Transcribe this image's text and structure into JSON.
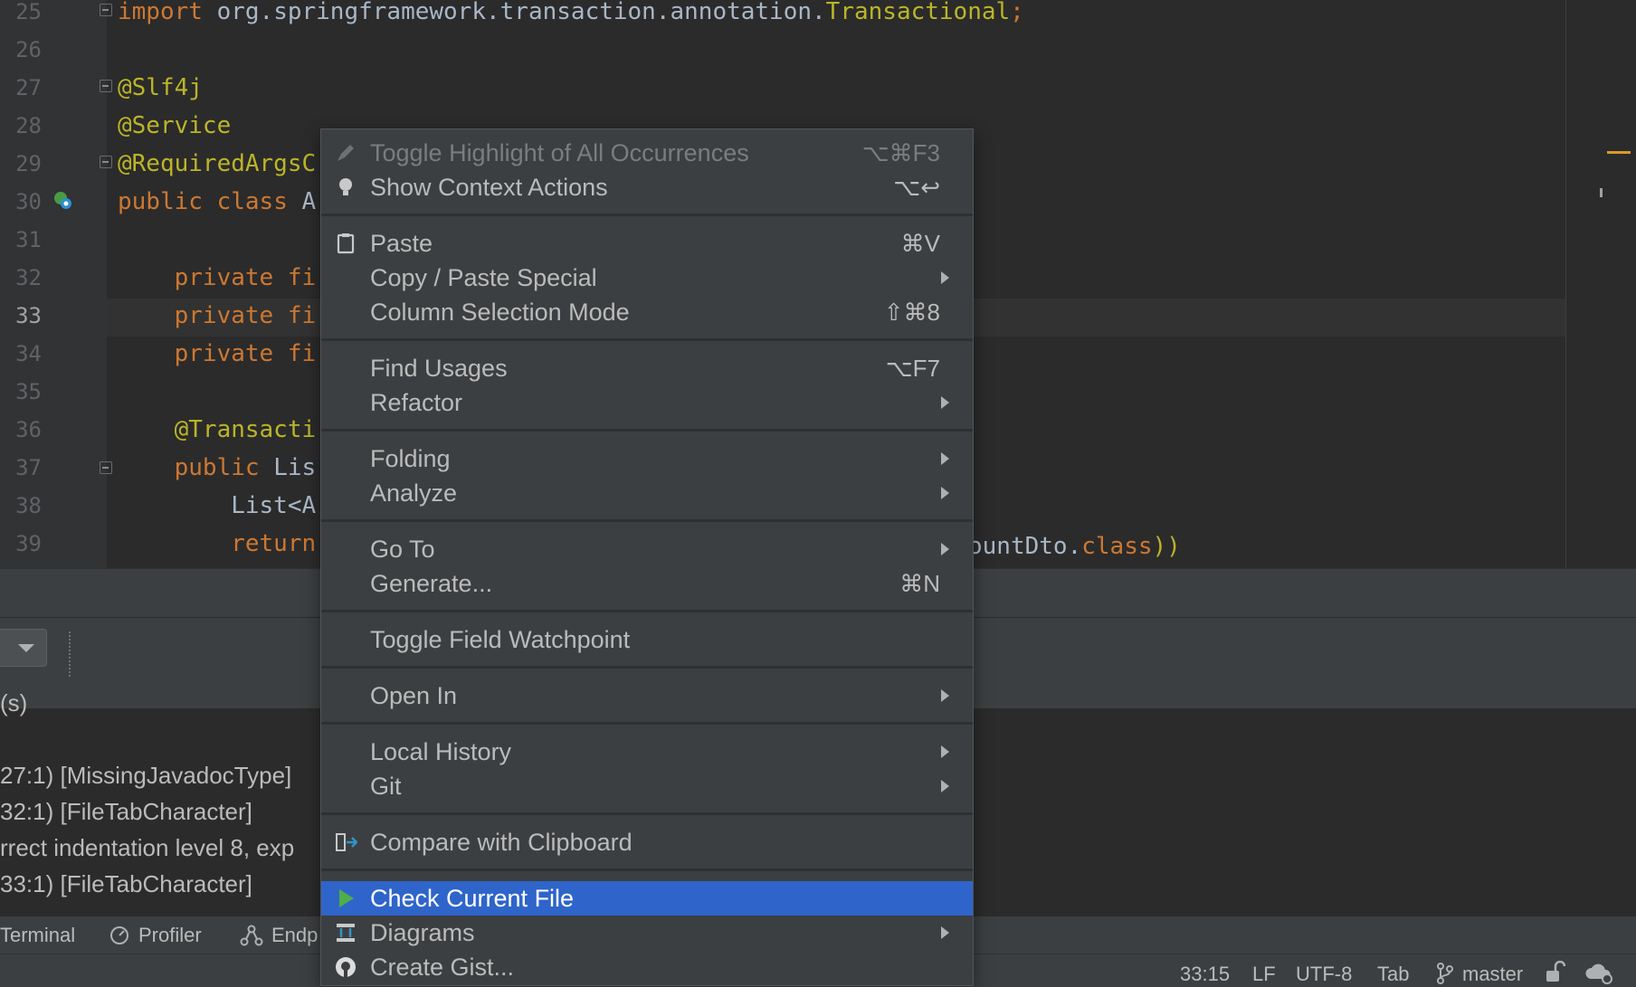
{
  "editor": {
    "lines": [
      {
        "num": "25",
        "segments": [
          {
            "t": "import ",
            "c": "kw"
          },
          {
            "t": "org.springframework.transaction.annotation.",
            "c": "plain"
          },
          {
            "t": "Transactional",
            "c": "ann"
          },
          {
            "t": ";",
            "c": "kw"
          }
        ]
      },
      {
        "num": "26",
        "segments": []
      },
      {
        "num": "27",
        "segments": [
          {
            "t": "@Slf4j",
            "c": "ann"
          }
        ]
      },
      {
        "num": "28",
        "segments": [
          {
            "t": "@Service",
            "c": "ann"
          }
        ]
      },
      {
        "num": "29",
        "segments": [
          {
            "t": "@RequiredArgsC",
            "c": "ann"
          }
        ]
      },
      {
        "num": "30",
        "segments": [
          {
            "t": "public ",
            "c": "kw"
          },
          {
            "t": "class ",
            "c": "kw"
          },
          {
            "t": "A",
            "c": "plain"
          }
        ]
      },
      {
        "num": "31",
        "segments": []
      },
      {
        "num": "32",
        "segments": [
          {
            "t": "    private ",
            "c": "kw"
          },
          {
            "t": "fi",
            "c": "kw"
          }
        ]
      },
      {
        "num": "33",
        "segments": [
          {
            "t": "    private ",
            "c": "kw"
          },
          {
            "t": "fi",
            "c": "kw"
          }
        ]
      },
      {
        "num": "34",
        "segments": [
          {
            "t": "    private ",
            "c": "kw"
          },
          {
            "t": "fi",
            "c": "kw"
          }
        ]
      },
      {
        "num": "35",
        "segments": []
      },
      {
        "num": "36",
        "segments": [
          {
            "t": "    @Transacti",
            "c": "ann"
          }
        ]
      },
      {
        "num": "37",
        "segments": [
          {
            "t": "    public ",
            "c": "kw"
          },
          {
            "t": "Lis",
            "c": "plain"
          }
        ]
      },
      {
        "num": "38",
        "segments": [
          {
            "t": "        List<A",
            "c": "plain"
          }
        ]
      },
      {
        "num": "39",
        "segments": [
          {
            "t": "        return",
            "c": "kw"
          }
        ]
      }
    ],
    "line39_tail": [
      {
        "t": "ountDto.",
        "c": "plain"
      },
      {
        "t": "class",
        "c": "kw"
      },
      {
        "t": "))",
        "c": "ann"
      }
    ]
  },
  "output": {
    "header_fragment": "(s)",
    "rows": [
      "27:1) [MissingJavadocType]",
      "32:1) [FileTabCharacter]",
      "rrect indentation level 8, exp",
      "33:1) [FileTabCharacter]"
    ]
  },
  "tabs": [
    "Terminal",
    "Profiler",
    "Endp"
  ],
  "status": {
    "position": "33:15",
    "line_sep": "LF",
    "encoding": "UTF-8",
    "indent": "Tab",
    "branch": "master"
  },
  "menu": {
    "items": [
      {
        "label": "Toggle Highlight of All Occurrences",
        "shortcut": "⌥⌘F3",
        "icon": "highlighter-icon",
        "disabled": true
      },
      {
        "label": "Show Context Actions",
        "shortcut": "⌥↩",
        "icon": "lightbulb-icon"
      },
      {
        "label": "Paste",
        "shortcut": "⌘V",
        "icon": "clipboard-icon"
      },
      {
        "label": "Copy / Paste Special",
        "submenu": true
      },
      {
        "label": "Column Selection Mode",
        "shortcut": "⇧⌘8"
      },
      {
        "label": "Find Usages",
        "shortcut": "⌥F7"
      },
      {
        "label": "Refactor",
        "submenu": true
      },
      {
        "label": "Folding",
        "submenu": true
      },
      {
        "label": "Analyze",
        "submenu": true
      },
      {
        "label": "Go To",
        "submenu": true
      },
      {
        "label": "Generate...",
        "shortcut": "⌘N"
      },
      {
        "label": "Toggle Field Watchpoint"
      },
      {
        "label": "Open In",
        "submenu": true
      },
      {
        "label": "Local History",
        "submenu": true
      },
      {
        "label": "Git",
        "submenu": true
      },
      {
        "label": "Compare with Clipboard",
        "icon": "compare-icon"
      },
      {
        "label": "Check Current File",
        "icon": "play-icon",
        "selected": true
      },
      {
        "label": "Diagrams",
        "submenu": true,
        "icon": "diagram-icon"
      },
      {
        "label": "Create Gist...",
        "icon": "github-icon"
      }
    ]
  },
  "colors": {
    "selection": "#2f65ca",
    "keyword": "#cc7832",
    "annotation": "#bbb529",
    "marker": "#d89b28"
  }
}
